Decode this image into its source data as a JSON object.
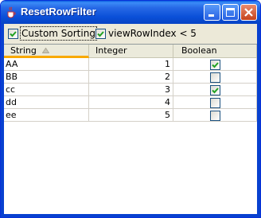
{
  "window": {
    "title": "ResetRowFilter"
  },
  "colors": {
    "titlebar": "#0a4fd8",
    "check": "#21a121",
    "sort_underline": "#f8a900"
  },
  "controls": {
    "custom_sorting": {
      "label": "Custom Sorting",
      "checked": true
    },
    "row_index_filter": {
      "label": "viewRowIndex < 5",
      "checked": true
    }
  },
  "table": {
    "columns": [
      "String",
      "Integer",
      "Boolean"
    ],
    "sorted_column": "String",
    "sort_direction": "ascending",
    "rows": [
      {
        "string": "AA",
        "integer": "1",
        "boolean": true
      },
      {
        "string": "BB",
        "integer": "2",
        "boolean": false
      },
      {
        "string": "cc",
        "integer": "3",
        "boolean": true
      },
      {
        "string": "dd",
        "integer": "4",
        "boolean": false
      },
      {
        "string": "ee",
        "integer": "5",
        "boolean": false
      }
    ]
  }
}
